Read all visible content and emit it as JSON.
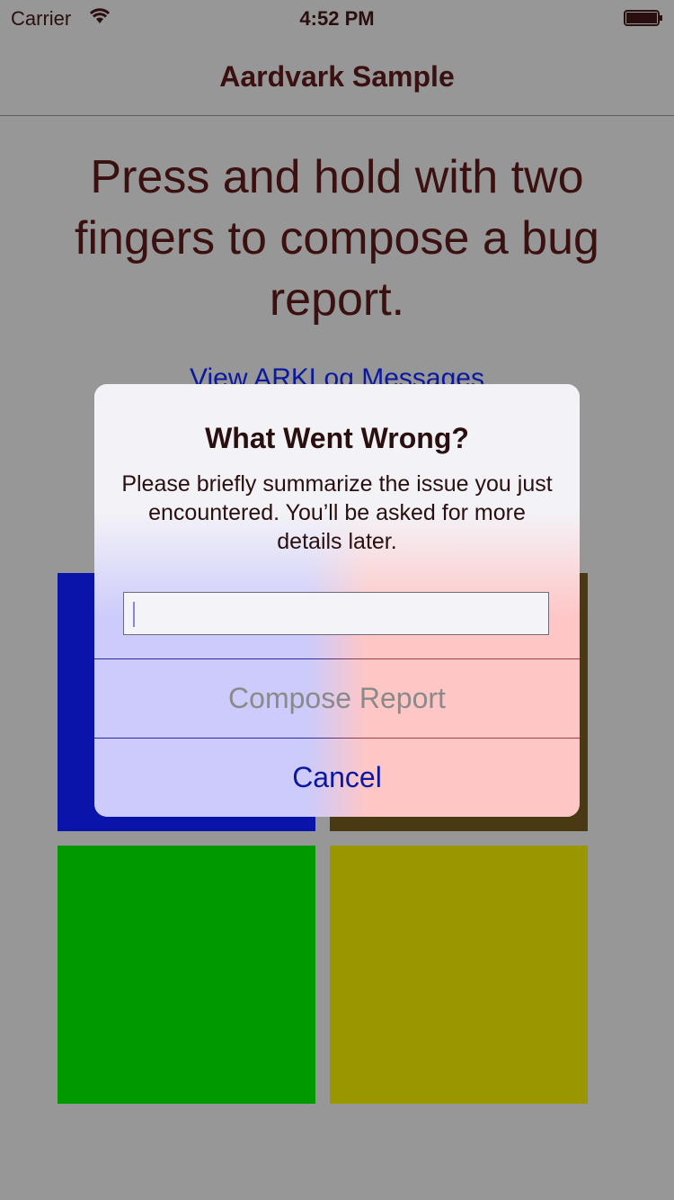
{
  "status_bar": {
    "carrier": "Carrier",
    "time": "4:52 PM",
    "wifi_icon": "wifi-icon",
    "battery_icon": "battery-icon"
  },
  "nav": {
    "title": "Aardvark Sample"
  },
  "main": {
    "instructions": "Press and hold with two fingers to compose a bug report.",
    "log_link": "View ARKLog Messages",
    "tiles": [
      {
        "color": "#0a14a8"
      },
      {
        "color": "#4a3a14"
      },
      {
        "color": "#009a00"
      },
      {
        "color": "#9a9600"
      }
    ]
  },
  "alert": {
    "title": "What Went Wrong?",
    "message": "Please briefly summarize the issue you just encountered. You’ll be asked for more details later.",
    "input_value": "",
    "compose_label": "Compose Report",
    "cancel_label": "Cancel"
  }
}
